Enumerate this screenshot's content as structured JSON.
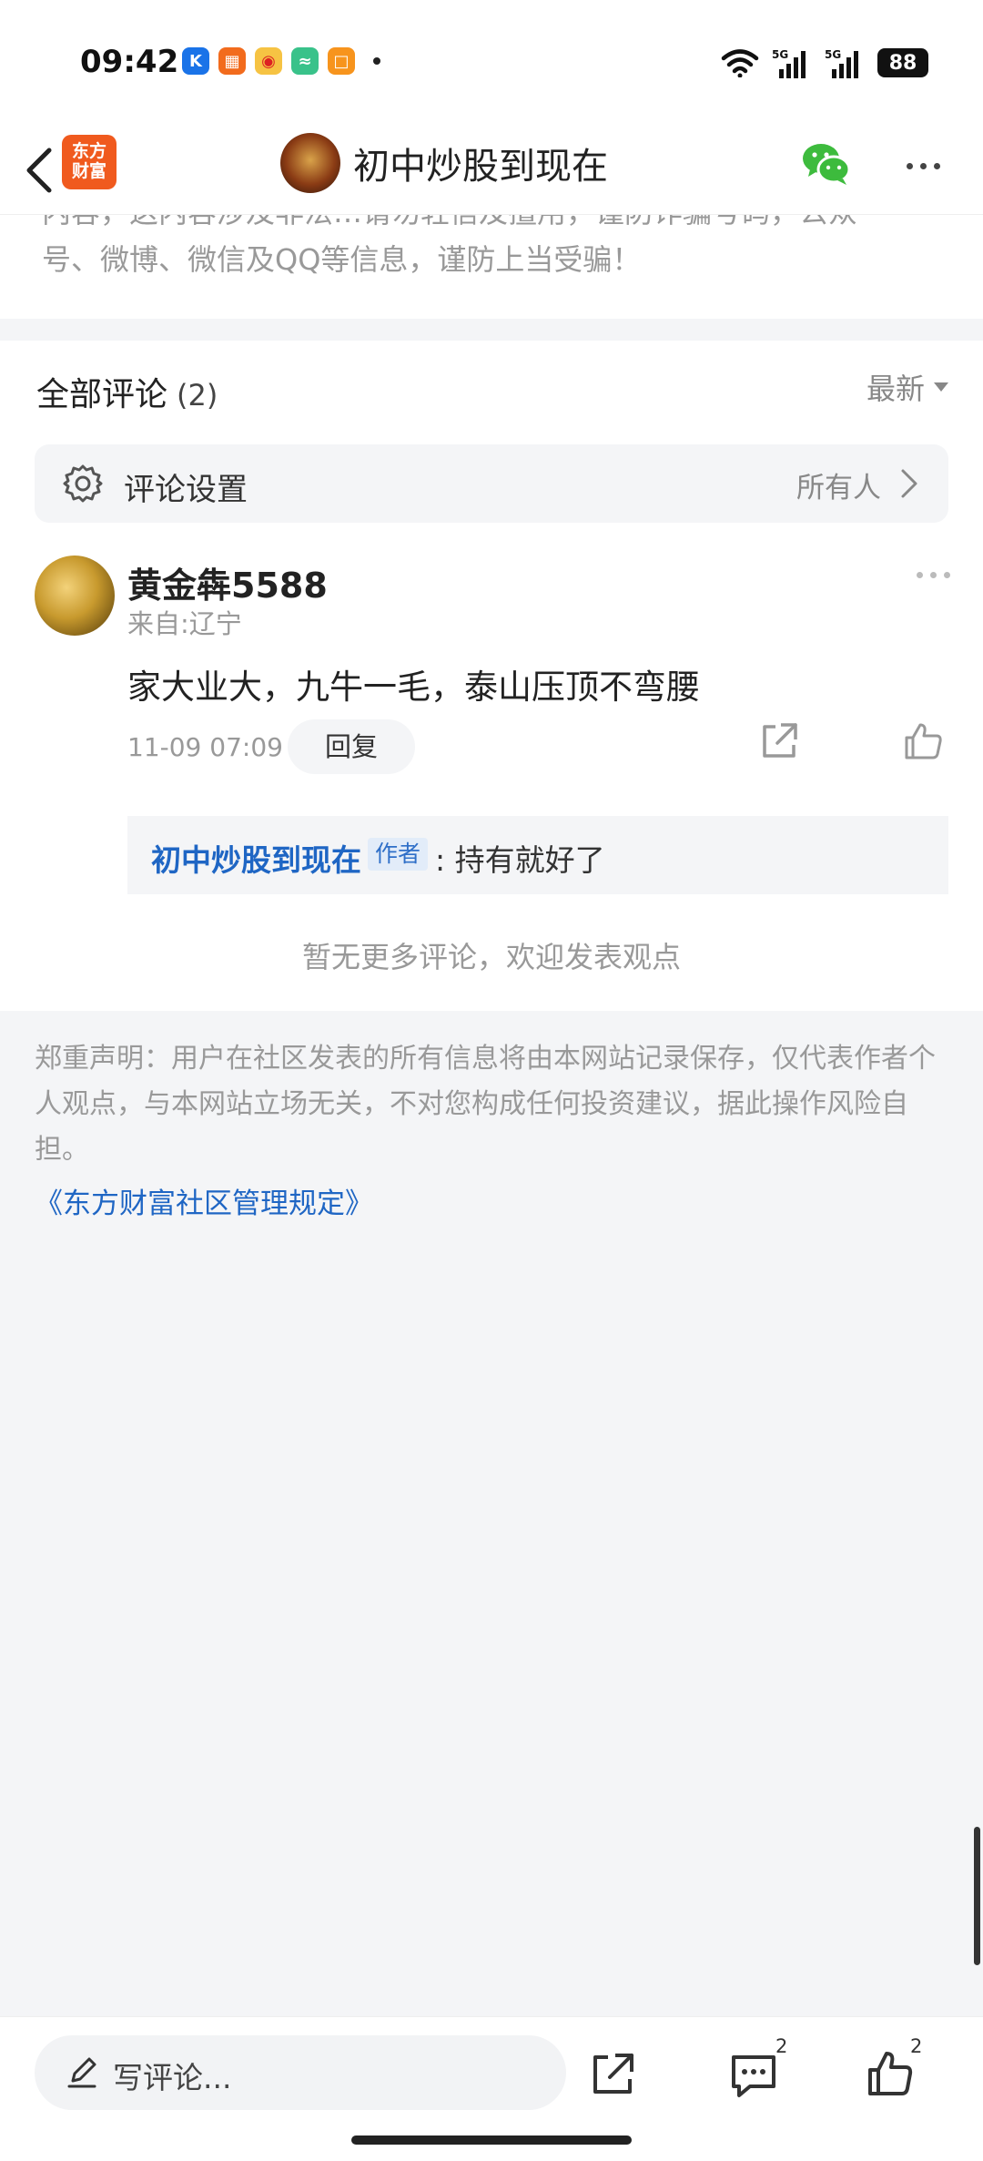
{
  "status_bar": {
    "time": "09:42",
    "network_label_1": "5G",
    "network_label_2": "5G",
    "battery": "88"
  },
  "header": {
    "back_icon": "chevron-left-icon",
    "logo_line1": "东方",
    "logo_line2": "财富",
    "title": "初中炒股到现在",
    "wechat_icon": "wechat-icon",
    "more_icon": "more-horizontal-icon"
  },
  "notice": {
    "line1": "内容，这内容涉及非法…请勿轻信及擅用，谨防诈骗号码，公众",
    "line2": "号、微博、微信及QQ等信息，谨防上当受骗！"
  },
  "comments": {
    "title": "全部评论",
    "count": "(2)",
    "sort_label": "最新",
    "settings": {
      "label": "评论设置",
      "value": "所有人"
    },
    "items": [
      {
        "username": "黄金犇5588",
        "location": "来自:辽宁",
        "text": "家大业大，九牛一毛，泰山压顶不弯腰",
        "time": "11-09 07:09",
        "reply_label": "回复",
        "replies": [
          {
            "author": "初中炒股到现在",
            "tag": "作者",
            "text": ": 持有就好了"
          }
        ]
      }
    ],
    "no_more": "暂无更多评论，欢迎发表观点"
  },
  "disclaimer": {
    "text": "郑重声明：用户在社区发表的所有信息将由本网站记录保存，仅代表作者个人观点，与本网站立场无关，不对您构成任何投资建议，据此操作风险自担。",
    "rules_link": "《东方财富社区管理规定》"
  },
  "bottom_bar": {
    "input_placeholder": "写评论...",
    "comment_count": "2",
    "like_count": "2"
  },
  "colors": {
    "brand_orange": "#f05a1e",
    "link_blue": "#1f66c4",
    "wechat_green": "#3dbb3d"
  }
}
